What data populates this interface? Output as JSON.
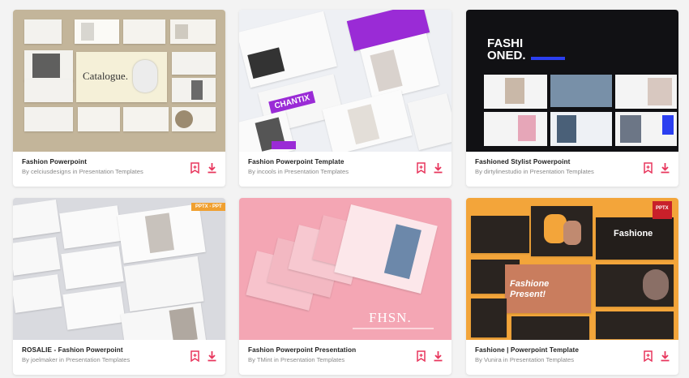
{
  "cards": [
    {
      "title": "Fashion Powerpoint",
      "author": "celciusdesigns",
      "category": "Presentation Templates",
      "thumb_text": "Catalogue."
    },
    {
      "title": "Fashion Powerpoint Template",
      "author": "incools",
      "category": "Presentation Templates",
      "thumb_text": "CHANTIX"
    },
    {
      "title": "Fashioned Stylist Powerpoint",
      "author": "dirtylinestudio",
      "category": "Presentation Templates",
      "thumb_text": "FASHI\nONED."
    },
    {
      "title": "ROSALIE - Fashion Powerpoint",
      "author": "joelmaker",
      "category": "Presentation Templates",
      "thumb_text": "PPTX - PPT"
    },
    {
      "title": "Fashion Powerpoint Presentation",
      "author": "TMint",
      "category": "Presentation Templates",
      "thumb_text": "FHSN."
    },
    {
      "title": "Fashione | Powerpoint Template",
      "author": "Vunira",
      "category": "Presentation Templates",
      "thumb_text": "Fashione",
      "thumb_text_2": "Fashione Present!",
      "thumb_badge": "PPTX"
    }
  ],
  "byline": {
    "by": "By",
    "in": "in"
  },
  "icons": {
    "bookmark": "bookmark-icon",
    "download": "download-icon"
  },
  "colors": {
    "accent": "#e8365d",
    "title": "#1f1f1f",
    "meta": "#8a8a8a",
    "background": "#f3f3f3"
  }
}
